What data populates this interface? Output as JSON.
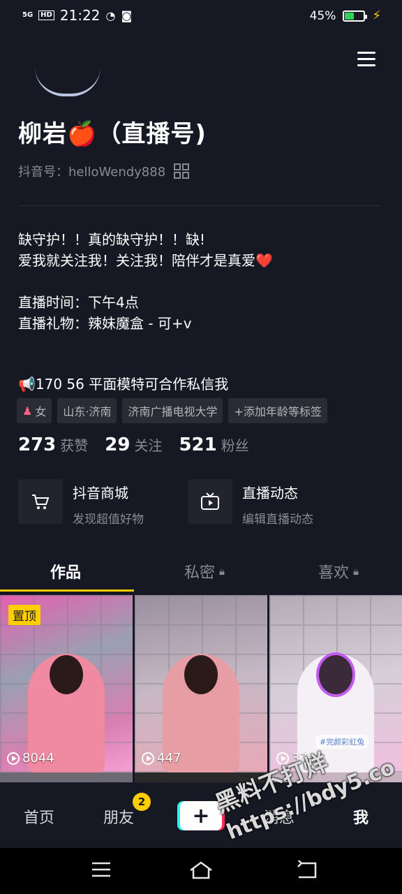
{
  "status_bar": {
    "network": "5G",
    "hd": "HD",
    "time": "21:22",
    "battery_percent": "45%",
    "battery_level": 0.45
  },
  "profile": {
    "name": "柳岩🍎（直播号)",
    "account_label": "抖音号：",
    "account_id": "helloWendy888"
  },
  "bio": {
    "line1": "缺守护！！真的缺守护！！缺!",
    "line2": "爱我就关注我！关注我！陪伴才是真爱❤️",
    "line3": "直播时间：下午4点",
    "line4": "直播礼物：辣妹魔盒 - 可+v"
  },
  "promo": "📢170   56 平面模特可合作私信我",
  "tags": {
    "gender_icon": "♟",
    "gender": "女",
    "location": "山东·济南",
    "school": "济南广播电视大学",
    "add": "+添加年龄等标签"
  },
  "stats": {
    "likes_num": "273",
    "likes_label": "获赞",
    "following_num": "29",
    "following_label": "关注",
    "fans_num": "521",
    "fans_label": "粉丝"
  },
  "features": {
    "shop_title": "抖音商城",
    "shop_sub": "发现超值好物",
    "live_title": "直播动态",
    "live_sub": "编辑直播动态"
  },
  "tabs": {
    "works": "作品",
    "private": "私密",
    "likes": "喜欢"
  },
  "videos": {
    "pinned_label": "置顶",
    "v1_plays": "8044",
    "v2_plays": "447",
    "v3_plays": "374",
    "v3_sticker": "#完颜彩虹兔"
  },
  "bottom_nav": {
    "home": "首页",
    "friends": "朋友",
    "friends_badge": "2",
    "create": "+",
    "messages": "消息",
    "me": "我"
  },
  "watermark": {
    "line1": "黑料不打烊",
    "line2": "https://bdy5.co"
  },
  "colors": {
    "background": "#161823",
    "accent": "#fece00",
    "secondary_text": "#8a8b91"
  }
}
